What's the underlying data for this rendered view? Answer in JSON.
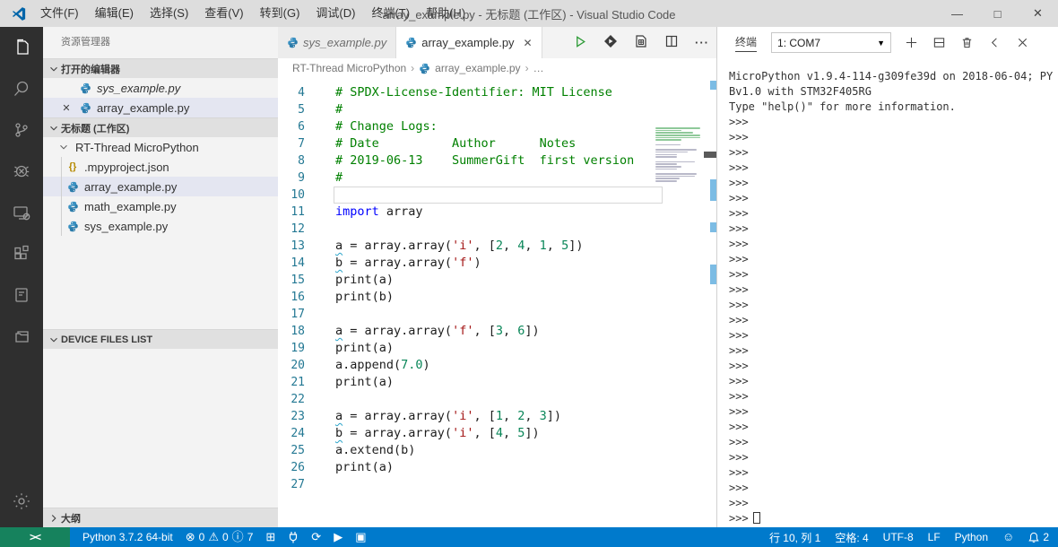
{
  "window": {
    "title": "array_example.py - 无标题 (工作区) - Visual Studio Code",
    "menus": [
      "文件(F)",
      "编辑(E)",
      "选择(S)",
      "查看(V)",
      "转到(G)",
      "调试(D)",
      "终端(T)",
      "帮助(H)"
    ],
    "controls": {
      "minimize": "—",
      "maximize": "□",
      "close": "✕"
    }
  },
  "activity_bar": {
    "icons": [
      "explorer-icon",
      "search-icon",
      "source-control-icon",
      "debug-icon",
      "device-icon",
      "extensions-icon",
      "notebook-icon",
      "folders-icon"
    ],
    "bottom_icon": "gear-icon"
  },
  "sidebar": {
    "title": "资源管理器",
    "open_editors": {
      "header": "打开的编辑器",
      "items": [
        {
          "label": "sys_example.py",
          "italic": true,
          "selected": false,
          "close": false
        },
        {
          "label": "array_example.py",
          "italic": false,
          "selected": true,
          "close": true
        }
      ]
    },
    "workspace": {
      "header": "无标题 (工作区)",
      "folder": "RT-Thread MicroPython",
      "files": [
        {
          "label": ".mpyproject.json",
          "icon": "json",
          "selected": false
        },
        {
          "label": "array_example.py",
          "icon": "python",
          "selected": true
        },
        {
          "label": "math_example.py",
          "icon": "python",
          "selected": false
        },
        {
          "label": "sys_example.py",
          "icon": "python",
          "selected": false
        }
      ]
    },
    "device_files": {
      "header": "DEVICE FILES LIST"
    },
    "outline": {
      "header": "大纲"
    }
  },
  "editor": {
    "tabs": [
      {
        "label": "sys_example.py"
      },
      {
        "label": "array_example.py",
        "close": "✕"
      }
    ],
    "breadcrumb": {
      "folder": "RT-Thread MicroPython",
      "file": "array_example.py",
      "more": "…"
    },
    "code_lines": [
      {
        "n": "4",
        "t": [
          [
            "c",
            "# SPDX-License-Identifier: MIT License"
          ]
        ]
      },
      {
        "n": "5",
        "t": [
          [
            "c",
            "#"
          ]
        ]
      },
      {
        "n": "6",
        "t": [
          [
            "c",
            "# Change Logs:"
          ]
        ]
      },
      {
        "n": "7",
        "t": [
          [
            "c",
            "# Date          Author      Notes"
          ]
        ]
      },
      {
        "n": "8",
        "t": [
          [
            "c",
            "# 2019-06-13    SummerGift  first version"
          ]
        ]
      },
      {
        "n": "9",
        "t": [
          [
            "c",
            "#"
          ]
        ]
      },
      {
        "n": "10",
        "t": [],
        "current": true
      },
      {
        "n": "11",
        "t": [
          [
            "k",
            "import"
          ],
          [
            "p",
            " array"
          ]
        ]
      },
      {
        "n": "12",
        "t": []
      },
      {
        "n": "13",
        "t": [
          [
            "v",
            "a"
          ],
          [
            "p",
            " = array.array("
          ],
          [
            "s",
            "'i'"
          ],
          [
            "p",
            ", ["
          ],
          [
            "n",
            "2"
          ],
          [
            "p",
            ", "
          ],
          [
            "n",
            "4"
          ],
          [
            "p",
            ", "
          ],
          [
            "n",
            "1"
          ],
          [
            "p",
            ", "
          ],
          [
            "n",
            "5"
          ],
          [
            "p",
            "])"
          ]
        ]
      },
      {
        "n": "14",
        "t": [
          [
            "v",
            "b"
          ],
          [
            "p",
            " = array.array("
          ],
          [
            "s",
            "'f'"
          ],
          [
            "p",
            ")"
          ]
        ]
      },
      {
        "n": "15",
        "t": [
          [
            "p",
            "print(a)"
          ]
        ]
      },
      {
        "n": "16",
        "t": [
          [
            "p",
            "print(b)"
          ]
        ]
      },
      {
        "n": "17",
        "t": []
      },
      {
        "n": "18",
        "t": [
          [
            "v",
            "a"
          ],
          [
            "p",
            " = array.array("
          ],
          [
            "s",
            "'f'"
          ],
          [
            "p",
            ", ["
          ],
          [
            "n",
            "3"
          ],
          [
            "p",
            ", "
          ],
          [
            "n",
            "6"
          ],
          [
            "p",
            "])"
          ]
        ]
      },
      {
        "n": "19",
        "t": [
          [
            "p",
            "print(a)"
          ]
        ]
      },
      {
        "n": "20",
        "t": [
          [
            "p",
            "a.append("
          ],
          [
            "n",
            "7.0"
          ],
          [
            "p",
            ")"
          ]
        ]
      },
      {
        "n": "21",
        "t": [
          [
            "p",
            "print(a)"
          ]
        ]
      },
      {
        "n": "22",
        "t": []
      },
      {
        "n": "23",
        "t": [
          [
            "v",
            "a"
          ],
          [
            "p",
            " = array.array("
          ],
          [
            "s",
            "'i'"
          ],
          [
            "p",
            ", ["
          ],
          [
            "n",
            "1"
          ],
          [
            "p",
            ", "
          ],
          [
            "n",
            "2"
          ],
          [
            "p",
            ", "
          ],
          [
            "n",
            "3"
          ],
          [
            "p",
            "])"
          ]
        ]
      },
      {
        "n": "24",
        "t": [
          [
            "v",
            "b"
          ],
          [
            "p",
            " = array.array("
          ],
          [
            "s",
            "'i'"
          ],
          [
            "p",
            ", ["
          ],
          [
            "n",
            "4"
          ],
          [
            "p",
            ", "
          ],
          [
            "n",
            "5"
          ],
          [
            "p",
            "])"
          ]
        ]
      },
      {
        "n": "25",
        "t": [
          [
            "p",
            "a.extend(b)"
          ]
        ]
      },
      {
        "n": "26",
        "t": [
          [
            "p",
            "print(a)"
          ]
        ]
      },
      {
        "n": "27",
        "t": []
      }
    ]
  },
  "terminal": {
    "tab_label": "终端",
    "dropdown_value": "1: COM7",
    "banner_lines": [
      "MicroPython v1.9.4-114-g309fe39d on 2018-06-04; PY",
      "Bv1.0 with STM32F405RG",
      "Type \"help()\" for more information."
    ],
    "prompt": ">>>",
    "prompt_count": 27
  },
  "status_bar": {
    "remote_glyph": "><",
    "interpreter": "Python 3.7.2 64-bit",
    "problems": {
      "errors": "0",
      "warnings": "0",
      "infos": "7"
    },
    "line_col": "行 10, 列 1",
    "spaces": "空格: 4",
    "encoding": "UTF-8",
    "eol": "LF",
    "language": "Python",
    "bell_count": "2"
  },
  "colors": {
    "statusbar": "#007acc",
    "remote": "#16825d",
    "activitybar": "#2f2f2f",
    "selection": "#e4e6f1",
    "comment": "#008000",
    "keyword": "#0000ff",
    "string": "#a31515",
    "number": "#098658",
    "line_number": "#237893"
  }
}
